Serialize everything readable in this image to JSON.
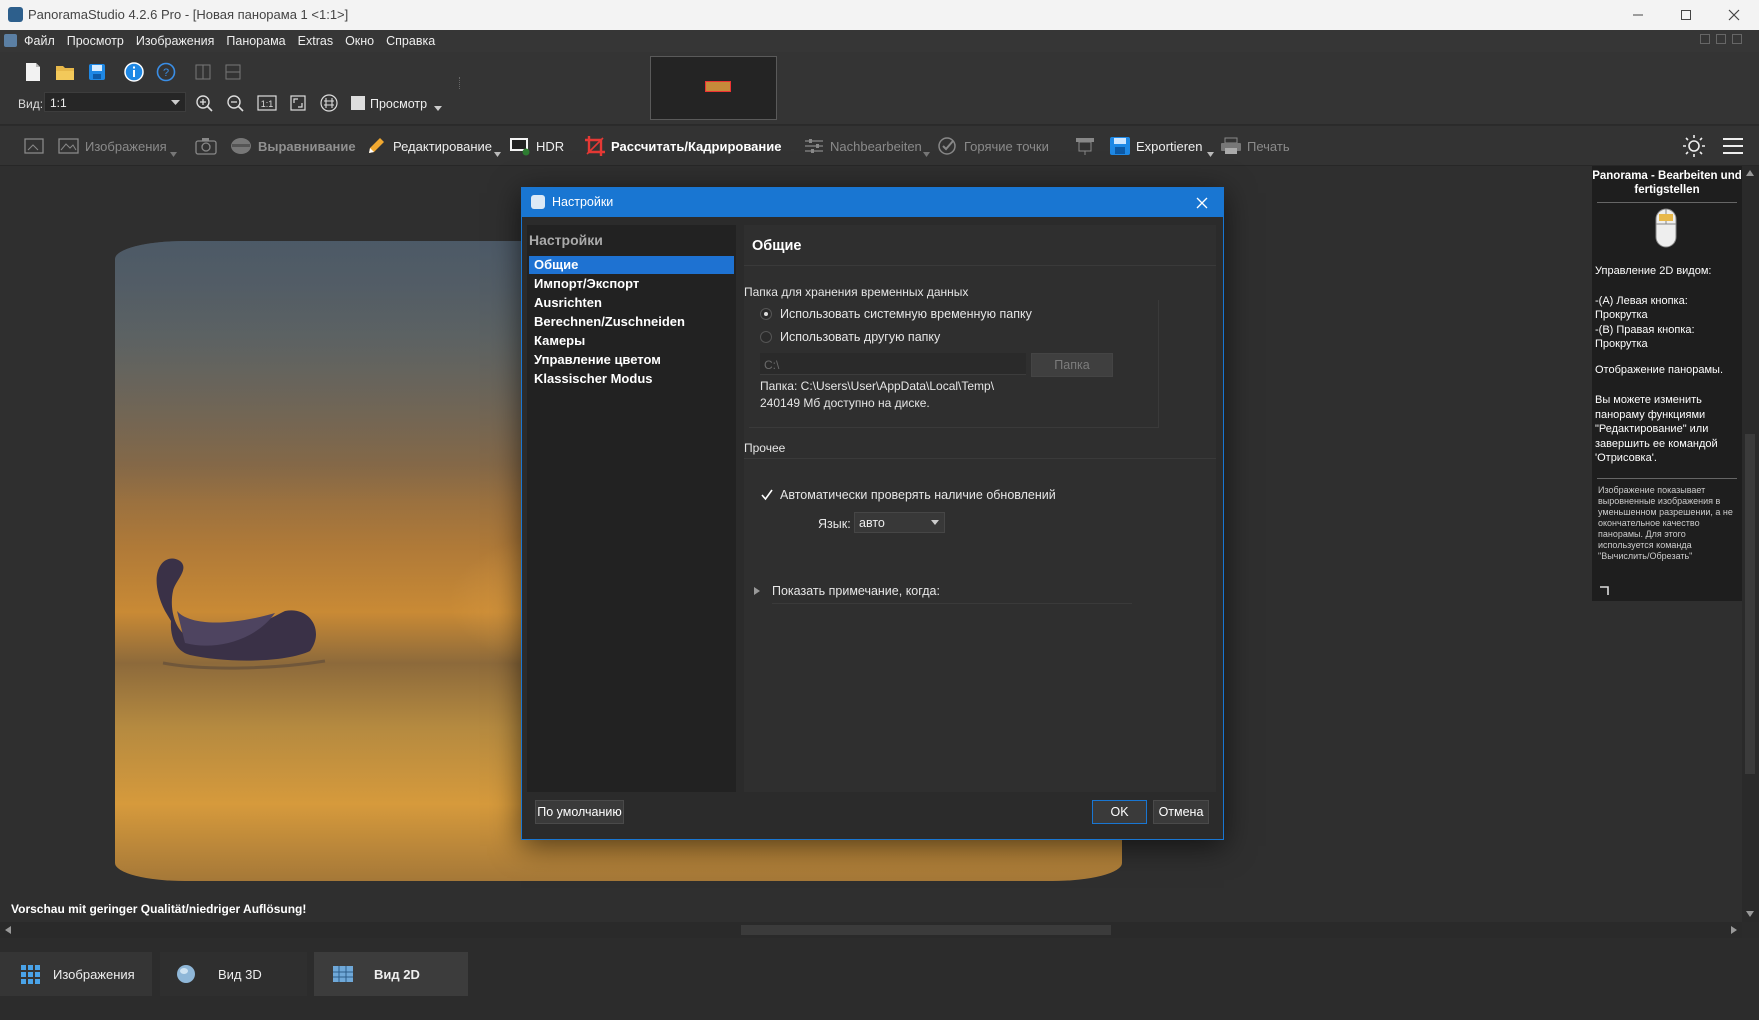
{
  "window": {
    "title": "PanoramaStudio 4.2.6 Pro - [Новая панорама 1 <1:1>]"
  },
  "menu": [
    "Файл",
    "Просмотр",
    "Изображения",
    "Панорама",
    "Extras",
    "Окно",
    "Справка"
  ],
  "toolbar": {
    "view_label": "Вид:",
    "view_value": "1:1",
    "preview_label": "Просмотр"
  },
  "workflow": {
    "images": "Изображения",
    "align": "Выравнивание",
    "edit": "Редактирование",
    "hdr": "HDR",
    "render": "Рассчитать/Кадрирование",
    "postprocess": "Nachbearbeiten",
    "hotspots": "Горячие точки",
    "export": "Exportieren",
    "print": "Печать"
  },
  "canvas": {
    "lowq_notice": "Vorschau mit geringer Qualität/niedriger Auflösung!"
  },
  "right_panel": {
    "title": "Panorama - Bearbeiten und fertigstellen",
    "control_title": "Управление 2D видом:",
    "lines": [
      "-(A) Левая кнопка: Прокрутка",
      "-(B) Правая кнопка: Прокрутка"
    ],
    "display": "Отображение панорамы.",
    "hint": "Вы можете изменить панораму функциями \"Редактирование\" или завершить ее командой 'Отрисовка'.",
    "note": "Изображение показывает выровненные изображения в уменьшенном разрешении, а не окончательное качество панорамы. Для этого используется команда \"Вычислить/Обрезать\""
  },
  "bottom_tabs": [
    "Изображения",
    "Вид 3D",
    "Вид 2D"
  ],
  "dialog": {
    "title": "Настройки",
    "nav_header": "Настройки",
    "nav_items": [
      "Общие",
      "Импорт/Экспорт",
      "Ausrichten",
      "Berechnen/Zuschneiden",
      "Камеры",
      "Управление цветом",
      "Klassischer Modus"
    ],
    "nav_selected": 0,
    "section_title": "Общие",
    "temp_group": "Папка для хранения временных данных",
    "radio_system": "Использовать системную временную папку",
    "radio_other": "Использовать другую папку",
    "path_value": "C:\\",
    "folder_button": "Папка",
    "folder_info_1": "Папка: C:\\Users\\User\\AppData\\Local\\Temp\\",
    "folder_info_2": "240149 Мб доступно на диске.",
    "misc_group": "Прочее",
    "auto_update": "Автоматически проверять наличие обновлений",
    "auto_update_checked": true,
    "language_label": "Язык:",
    "language_value": "авто",
    "show_note": "Показать примечание, когда:",
    "default_button": "По умолчанию",
    "ok_button": "OK",
    "cancel_button": "Отмена"
  },
  "colors": {
    "accent": "#1976d2",
    "selection": "#1e72d2",
    "render_icon": "#e53935"
  }
}
